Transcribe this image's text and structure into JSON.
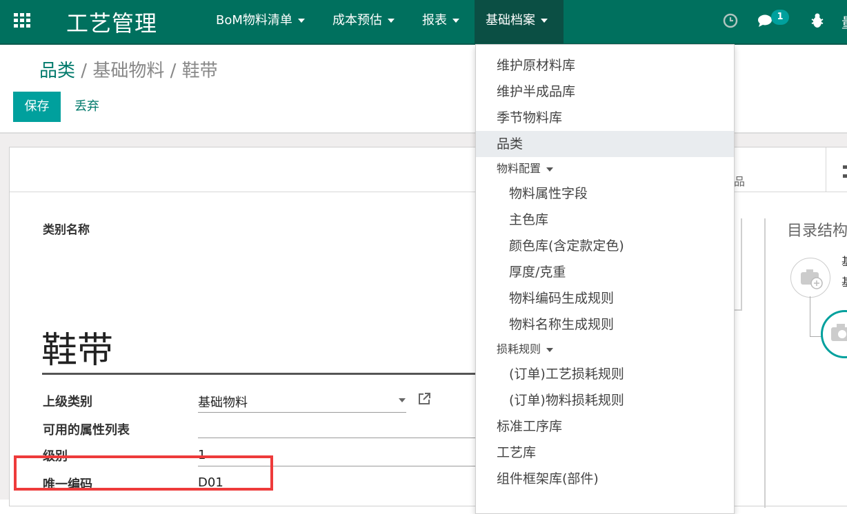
{
  "navbar": {
    "brand": "工艺管理",
    "menus": [
      {
        "label": "BoM物料清单"
      },
      {
        "label": "成本预估"
      },
      {
        "label": "报表"
      },
      {
        "label": "基础档案"
      }
    ],
    "message_count": "1",
    "user_partial": "量"
  },
  "breadcrumb": {
    "root": "品类",
    "sep1": " / ",
    "middle": "基础物料",
    "sep2": " / ",
    "current": "鞋带"
  },
  "toolbar": {
    "save_label": "保存",
    "discard_label": "丢弃"
  },
  "form": {
    "stat_partial": "品",
    "category_name_label": "类别名称",
    "title": "鞋带",
    "fields": {
      "parent_label": "上级类别",
      "parent_value": "基础物料",
      "attr_list_label": "可用的属性列表",
      "level_label": "级别",
      "level_value": "1",
      "code_label": "唯一编码",
      "code_value": "D01"
    },
    "org_chart_title": "目录结构",
    "org_text_1": "基",
    "org_text_2": "基"
  },
  "dropdown": {
    "items": [
      {
        "label": "维护原材料库"
      },
      {
        "label": "维护半成品库"
      },
      {
        "label": "季节物料库"
      },
      {
        "label": "品类"
      },
      {
        "label": "物料配置"
      },
      {
        "label": "物料属性字段"
      },
      {
        "label": "主色库"
      },
      {
        "label": "颜色库(含定款定色)"
      },
      {
        "label": "厚度/克重"
      },
      {
        "label": "物料编码生成规则"
      },
      {
        "label": "物料名称生成规则"
      },
      {
        "label": "损耗规则"
      },
      {
        "label": "(订单)工艺损耗规则"
      },
      {
        "label": "(订单)物料损耗规则"
      },
      {
        "label": "标准工序库"
      },
      {
        "label": "工艺库"
      },
      {
        "label": "组件框架库(部件)"
      }
    ]
  },
  "colors": {
    "navbar": "#00705e",
    "primary": "#00a09d",
    "highlight": "#ee3b3b"
  }
}
